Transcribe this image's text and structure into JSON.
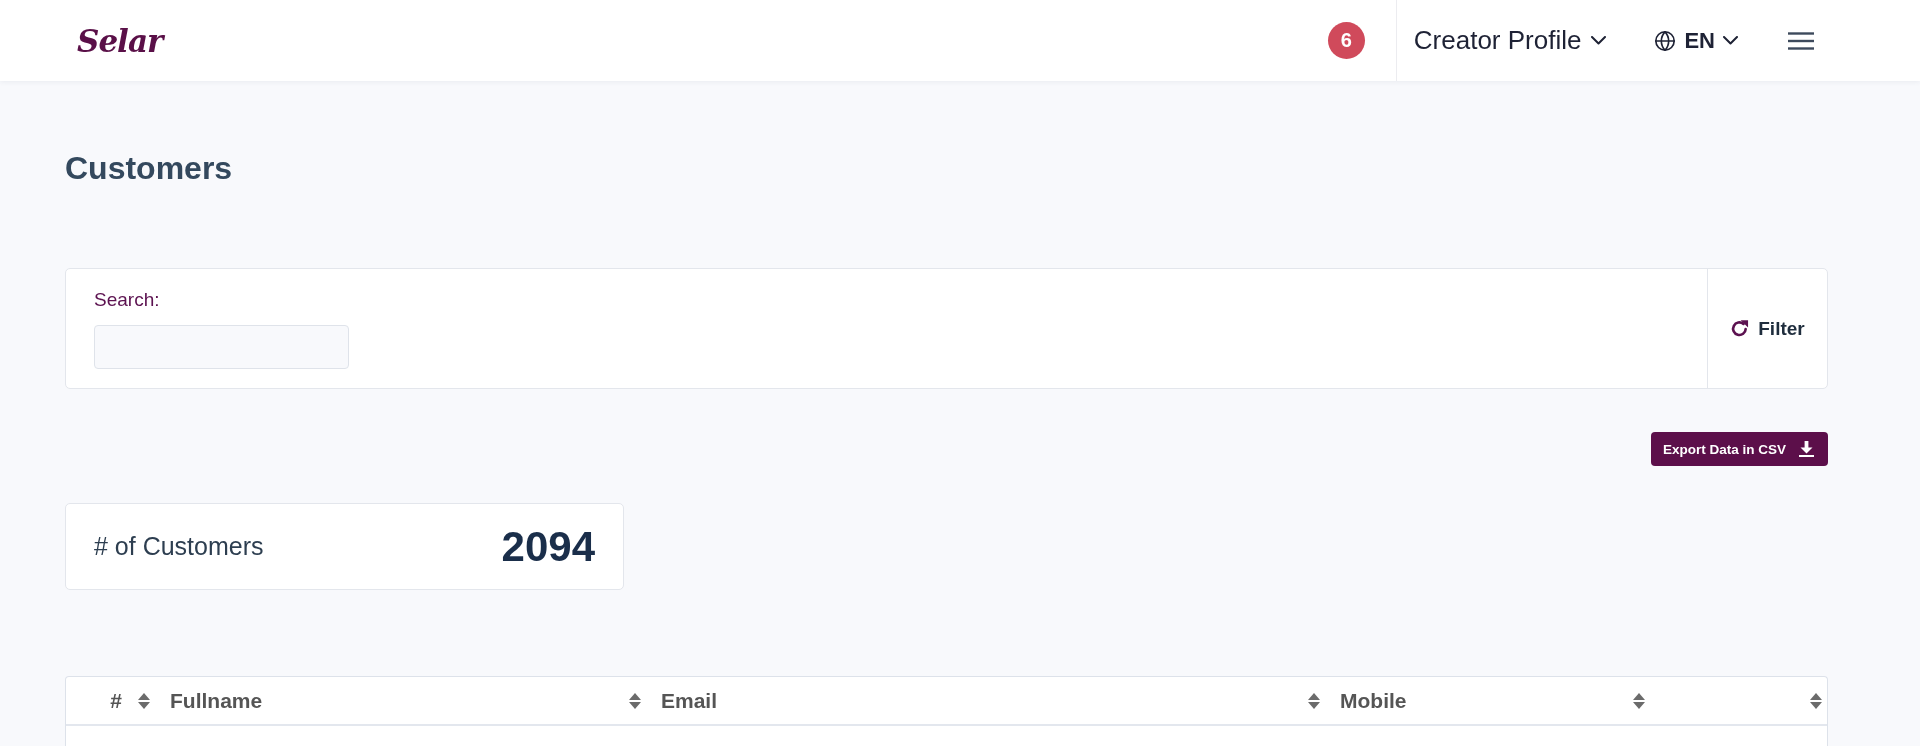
{
  "header": {
    "logo": "Selar",
    "notification_count": "6",
    "profile_menu": "Creator Profile",
    "language": "EN"
  },
  "page": {
    "title": "Customers"
  },
  "search_panel": {
    "label": "Search:",
    "filter_button": "Filter"
  },
  "export_button": "Export Data in CSV",
  "stats": [
    {
      "label": "# of Customers",
      "value": "2094"
    }
  ],
  "table": {
    "columns": [
      {
        "label": "#",
        "sortable": true
      },
      {
        "label": "Fullname",
        "sortable": true
      },
      {
        "label": "Email",
        "sortable": true
      },
      {
        "label": "Mobile",
        "sortable": true
      },
      {
        "sortable": true
      }
    ]
  }
}
